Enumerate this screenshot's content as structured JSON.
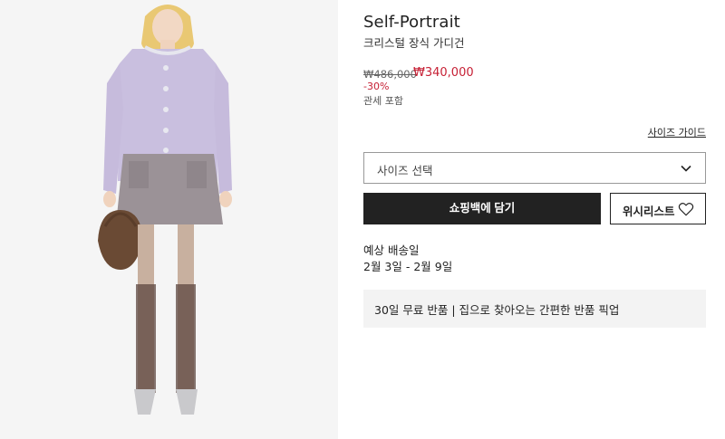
{
  "product": {
    "brand": "Self-Portrait",
    "name": "크리스털 장식 가디건",
    "original_price": "₩486,000",
    "sale_price": "₩340,000",
    "discount": "-30%",
    "tax_note": "관세 포함"
  },
  "size": {
    "guide_label": "사이즈 가이드",
    "select_label": "사이즈 선택"
  },
  "actions": {
    "add_to_bag_label": "쇼핑백에 담기",
    "wishlist_label": "위시리스트"
  },
  "delivery": {
    "title": "예상 배송일",
    "dates": "2월 3일 - 2월 9일"
  },
  "returns": {
    "text": "30일 무료 반품 | 집으로 찾아오는 간편한 반품 픽업"
  },
  "colors": {
    "sale": "#c62035",
    "button_dark": "#222222",
    "info_box": "#f3f3f3",
    "cardigan": "#c9bfdf"
  }
}
